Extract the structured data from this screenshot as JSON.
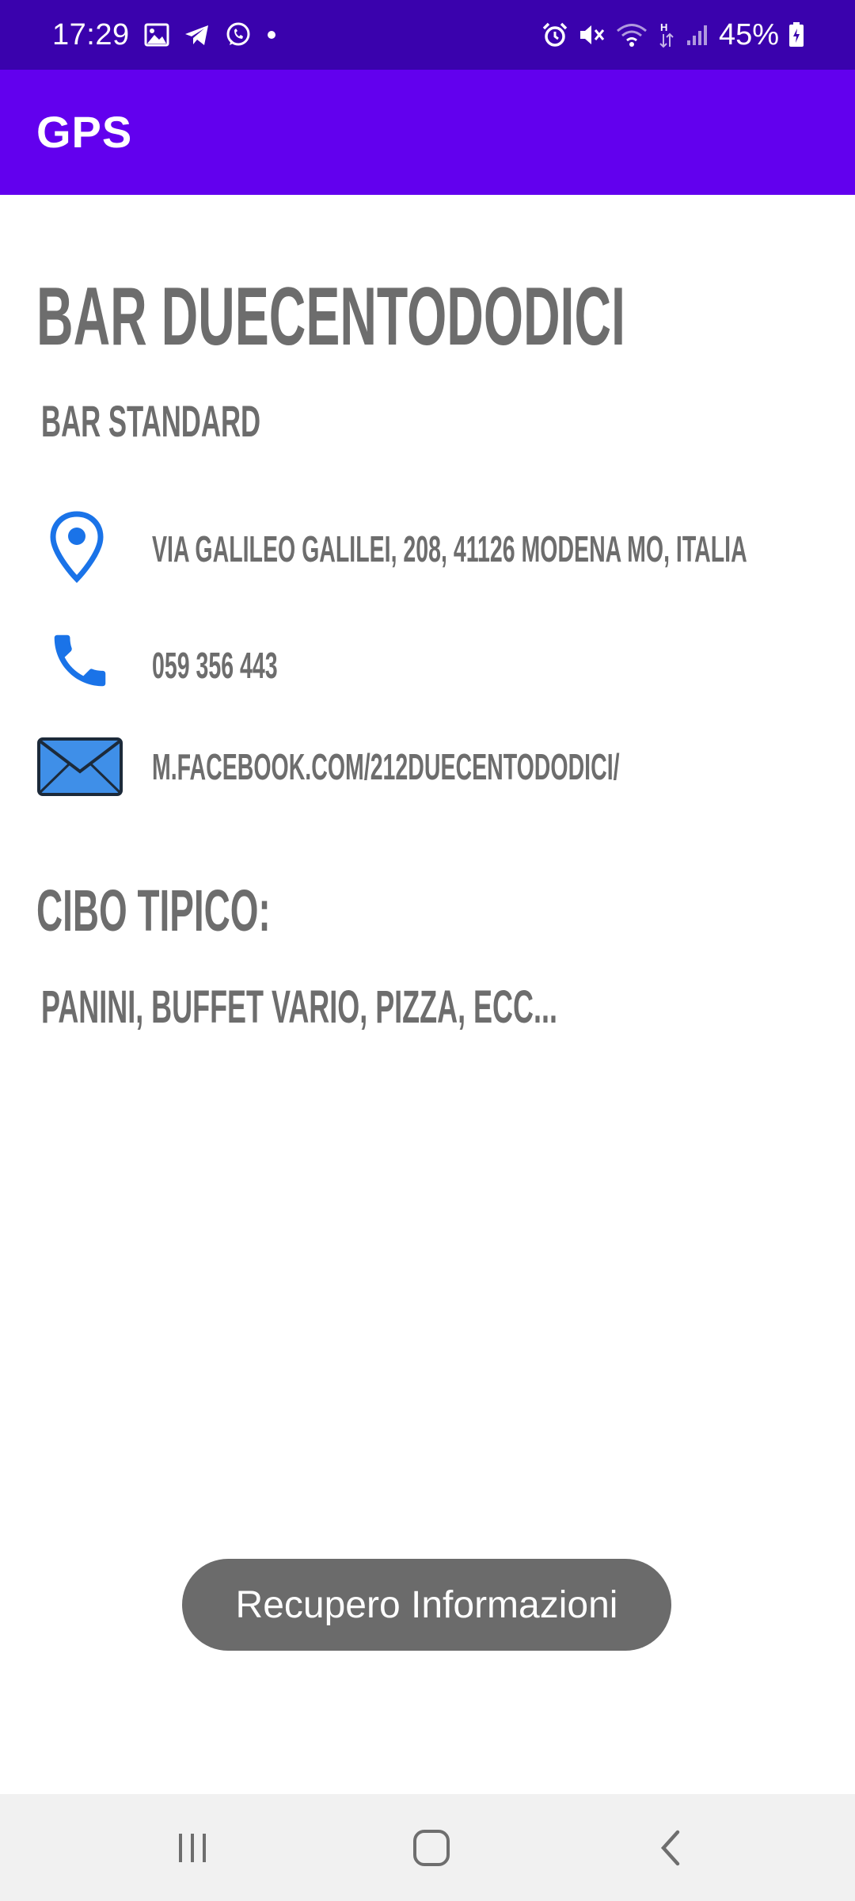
{
  "status_bar": {
    "time": "17:29",
    "battery": "45%",
    "notification_icons": [
      "image-icon",
      "telegram-icon",
      "whatsapp-icon",
      "dot-icon"
    ],
    "system_icons": [
      "alarm-icon",
      "mute-icon",
      "wifi-icon",
      "data-h-icon",
      "signal-icon",
      "battery-icon"
    ]
  },
  "app_bar": {
    "title": "GPS"
  },
  "place": {
    "name": "BAR DUECENTODODICI",
    "category": "BAR STANDARD",
    "address": "VIA GALILEO GALILEI, 208, 41126 MODENA MO, ITALIA",
    "phone": "059 356 443",
    "website": "M.FACEBOOK.COM/212DUECENTODODICI/"
  },
  "food": {
    "title": "CIBO TIPICO:",
    "items": "PANINI, BUFFET VARIO, PIZZA, ECC..."
  },
  "toast": {
    "message": "Recupero Informazioni"
  },
  "colors": {
    "status_bar": "#3a02ad",
    "app_bar": "#6200ee",
    "text_gray": "#6d6d6d",
    "icon_blue": "#1a73e8",
    "toast_bg": "#6b6b6b",
    "nav_bar_bg": "#f1f1f1"
  },
  "navigation": {
    "recents": "recents-icon",
    "home": "home-icon",
    "back": "back-icon"
  }
}
